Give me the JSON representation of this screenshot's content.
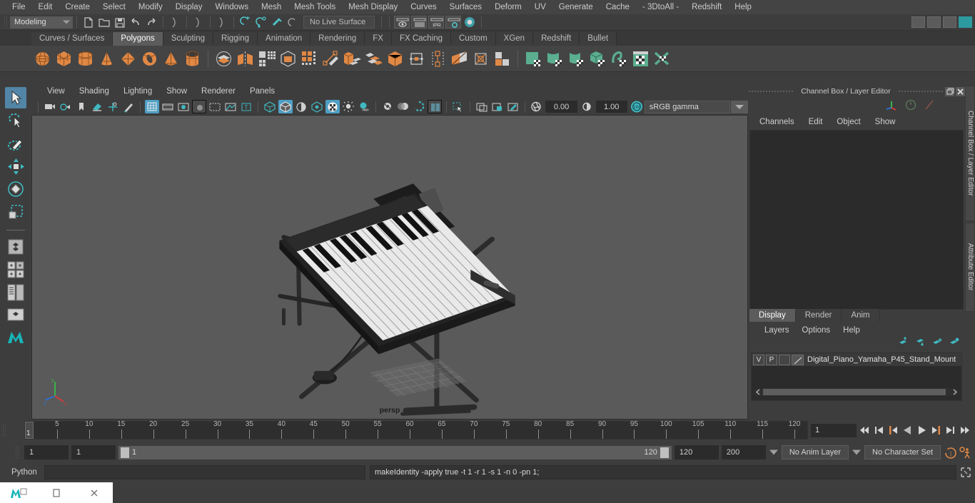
{
  "menubar": {
    "items": [
      "File",
      "Edit",
      "Create",
      "Select",
      "Modify",
      "Display",
      "Windows",
      "Mesh",
      "Mesh Tools",
      "Mesh Display",
      "Curves",
      "Surfaces",
      "Deform",
      "UV",
      "Generate",
      "Cache",
      "- 3DtoAll -",
      "Redshift",
      "Help"
    ]
  },
  "statusbar": {
    "mode": "Modeling",
    "live_surface": "No Live Surface",
    "icons": [
      "new-scene-icon",
      "open-scene-icon",
      "save-scene-icon",
      "undo-icon",
      "redo-icon",
      "select-by-hierarchy-icon",
      "select-by-object-icon",
      "select-by-component-icon",
      "snap-to-grid-icon",
      "snap-to-curve-icon",
      "snap-to-point-icon",
      "snap-to-projected-center-icon",
      "render-view-icon",
      "render-region-icon",
      "ipr-render-icon",
      "render-settings-icon",
      "hypershade-icon"
    ]
  },
  "shelf": {
    "tabs": [
      "Curves / Surfaces",
      "Polygons",
      "Sculpting",
      "Rigging",
      "Animation",
      "Rendering",
      "FX",
      "FX Caching",
      "Custom",
      "XGen",
      "Redshift",
      "Bullet"
    ],
    "active_tab": "Polygons",
    "icons": [
      "poly-sphere-icon",
      "poly-cube-icon",
      "poly-cylinder-icon",
      "poly-cone-icon",
      "poly-plane-icon",
      "poly-torus-icon",
      "poly-pyramid-icon",
      "poly-pipe-icon",
      "combine-icon",
      "separate-icon",
      "smooth-icon",
      "boolean-icon",
      "quad-draw-icon",
      "create-poly-icon",
      "extrude-icon",
      "bevel-icon",
      "multi-cut-icon",
      "target-weld-icon",
      "bridge-icon",
      "append-polygon-icon",
      "wedge-icon",
      "poke-icon",
      "mirror-icon",
      "offset-edge-loop-icon",
      "uv-editor-icon",
      "uv-planar-icon",
      "uv-cylindrical-icon",
      "uv-automatic-icon",
      "uv-unfold-icon",
      "uv-layout-icon",
      "uv-cut-sew-icon"
    ]
  },
  "toolbox": {
    "tools": [
      "select-tool",
      "lasso-select-tool",
      "paint-select-tool",
      "move-tool",
      "rotate-tool",
      "scale-tool",
      "last-tool-used",
      "layout-single-pane",
      "layout-four-pane",
      "layout-two-pane-side",
      "layout-outliner-persp",
      "layout-persp-graph",
      "maya-logo"
    ],
    "active_tool": "select-tool"
  },
  "viewport": {
    "panel_menu": [
      "View",
      "Shading",
      "Lighting",
      "Show",
      "Renderer",
      "Panels"
    ],
    "exposure": "0.00",
    "gamma_value": "1.00",
    "color_space": "sRGB gamma",
    "camera_label": "persp",
    "gamma_toggle": "ON",
    "axis_labels": [
      "x",
      "y",
      "z"
    ],
    "scene_object": "Digital Piano Yamaha P45 on X-stand"
  },
  "channelbox": {
    "title": "Channel Box / Layer Editor",
    "menu": [
      "Channels",
      "Edit",
      "Object",
      "Show"
    ],
    "side_tabs": [
      "Channel Box / Layer Editor",
      "Attribute Editor"
    ]
  },
  "layereditor": {
    "tabs": [
      "Display",
      "Render",
      "Anim"
    ],
    "active_tab": "Display",
    "menu": [
      "Layers",
      "Options",
      "Help"
    ],
    "buttons": [
      "move-layer-up-icon",
      "move-layer-down-icon",
      "new-layer-from-selected-icon",
      "new-layer-icon"
    ],
    "layers": [
      {
        "visibility": "V",
        "playback": "P",
        "shading": "",
        "name": "Digital_Piano_Yamaha_P45_Stand_Mount"
      }
    ]
  },
  "timeslider": {
    "ticks": [
      5,
      10,
      15,
      20,
      25,
      30,
      35,
      40,
      45,
      50,
      55,
      60,
      65,
      70,
      75,
      80,
      85,
      90,
      95,
      100,
      105,
      110,
      115,
      120
    ],
    "current_frame_marker": "1",
    "current_frame_field": "1",
    "playback_buttons": [
      "go-to-start-icon",
      "step-back-keyframe-icon",
      "step-back-frame-icon",
      "play-backwards-icon",
      "play-forwards-icon",
      "step-forward-frame-icon",
      "step-forward-keyframe-icon",
      "go-to-end-icon"
    ]
  },
  "rangeslider": {
    "anim_start": "1",
    "range_start": "1",
    "range_bar_low": "1",
    "range_bar_high": "120",
    "range_end": "120",
    "anim_end": "200",
    "anim_layer": "No Anim Layer",
    "character_set": "No Character Set",
    "buttons": [
      "auto-keyframe-icon",
      "animation-preferences-icon"
    ]
  },
  "commandline": {
    "language": "Python",
    "input_value": "",
    "output": "makeIdentity -apply true -t 1 -r 1 -s 1 -n 0 -pn 1;",
    "script_editor_icon": "script-editor-icon"
  },
  "taskbar": {
    "items": [
      "maya-app-icon",
      "windows-maximize-icon",
      "window-close-icon"
    ]
  },
  "colors": {
    "accent_teal": "#4f9fc4",
    "shelf_orange": "#e08845",
    "shelf_green": "#5bae8f",
    "panel_bg": "#3d3d3d",
    "viewport_bg": "#5a5a5a",
    "selection_blue": "#5285a6"
  }
}
